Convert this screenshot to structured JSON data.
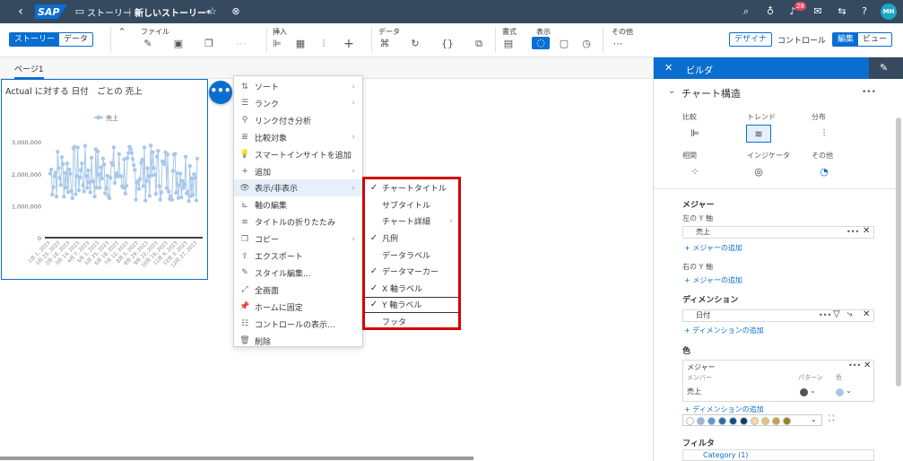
{
  "topbar": {
    "back": "‹",
    "logo": "SAP",
    "story_label": "ストーリー",
    "doc_title": "新しいストーリー*",
    "badge": "28",
    "avatar": "MH"
  },
  "toolbar": {
    "story_tab": "ストーリー",
    "data_tab": "データ",
    "file_label": "ファイル",
    "insert_label": "挿入",
    "data_label": "データ",
    "format_label": "書式",
    "view_label": "表示",
    "other_label": "その他",
    "designer_btn": "デザイナ",
    "control_btn": "コントロール",
    "edit_tab": "編集",
    "view_tab": "ビュー"
  },
  "page": {
    "tab_label": "ページ1"
  },
  "chart": {
    "title": "Actual に対する 日付　ごとの 売上",
    "legend": "売上",
    "color": "#a8c8ea"
  },
  "chart_data": {
    "type": "line",
    "title": "Actual に対する 日付　ごとの 売上",
    "series": [
      {
        "name": "売上"
      }
    ],
    "y_ticks": [
      "3,000,000",
      "2,000,000",
      "1,000,000",
      "0"
    ],
    "x_ticks": [
      "1月 1, 2023",
      "1月 25, 2023",
      "2月 18, 2023",
      "3月 14, 2023",
      "4月 7, 2023",
      "5月 1, 2023",
      "5月 25, 2023",
      "6月 18, 2023",
      "7月 12, 2023",
      "8月 5, 2023",
      "8月 29, 2023",
      "9月 22, 2023",
      "10月 16, 2023",
      "11月 9, 2023",
      "12月 3, 2023",
      "12月 27, 2023"
    ],
    "ylim": [
      0,
      3200000
    ]
  },
  "context_menu": [
    {
      "icon": "⇅",
      "label": "ソート",
      "arrow": true
    },
    {
      "icon": "☰",
      "label": "ランク",
      "arrow": true
    },
    {
      "icon": "⚲",
      "label": "リンク付き分析",
      "arrow": false
    },
    {
      "icon": "≣",
      "label": "比較対象",
      "arrow": true
    },
    {
      "icon": "💡",
      "label": "スマートインサイトを追加",
      "arrow": false
    },
    {
      "icon": "+",
      "label": "追加",
      "arrow": true
    },
    {
      "icon": "👁",
      "label": "表示/非表示",
      "arrow": true,
      "highlight": true
    },
    {
      "icon": "⊾",
      "label": "軸の編集",
      "arrow": false
    },
    {
      "icon": "≡",
      "label": "タイトルの折りたたみ",
      "arrow": false
    },
    {
      "icon": "❐",
      "label": "コピー",
      "arrow": true
    },
    {
      "icon": "⇪",
      "label": "エクスポート",
      "arrow": false
    },
    {
      "icon": "✎",
      "label": "スタイル編集...",
      "arrow": false
    },
    {
      "icon": "⤢",
      "label": "全画面",
      "arrow": false
    },
    {
      "icon": "📌",
      "label": "ホームに固定",
      "arrow": false
    },
    {
      "icon": "☷",
      "label": "コントロールの表示...",
      "arrow": false
    },
    {
      "icon": "🗑",
      "label": "削除",
      "arrow": false
    }
  ],
  "submenu": [
    {
      "label": "チャートタイトル",
      "checked": true,
      "arrow": false
    },
    {
      "label": "サブタイトル",
      "checked": false,
      "arrow": false
    },
    {
      "label": "チャート詳細",
      "checked": false,
      "arrow": true
    },
    {
      "label": "凡例",
      "checked": true,
      "arrow": false
    },
    {
      "label": "データラベル",
      "checked": false,
      "arrow": false
    },
    {
      "label": "データマーカー",
      "checked": true,
      "arrow": false
    },
    {
      "label": "X 軸ラベル",
      "checked": true,
      "arrow": false
    },
    {
      "label": "Y 軸ラベル",
      "checked": true,
      "arrow": false
    },
    {
      "label": "フッタ",
      "checked": false,
      "arrow": false
    }
  ],
  "builder": {
    "header": "ビルダ",
    "structure_title": "チャート構造",
    "categories": [
      {
        "label": "比較",
        "icon": "⊫"
      },
      {
        "label": "トレンド",
        "icon": "≋"
      },
      {
        "label": "分布",
        "icon": "⫶"
      },
      {
        "label": "相関",
        "icon": "⁘"
      },
      {
        "label": "インジケータ",
        "icon": "◎"
      },
      {
        "label": "その他",
        "icon": "◔"
      }
    ],
    "measures_title": "メジャー",
    "left_axis": "左の Y 軸",
    "left_measure": "売上",
    "add_measure": "+ メジャーの追加",
    "right_axis": "右の Y 軸",
    "add_measure2": "+ メジャーの追加",
    "dimensions_title": "ディメンション",
    "dimension": "日付",
    "add_dimension": "+ ディメンションの追加",
    "color_title": "色",
    "color_measure": "メジャー",
    "member_col": "メンバー",
    "pattern_col": "パターン",
    "color_col": "色",
    "color_row": "売上",
    "add_dimension2": "+ ディメンションの追加",
    "palette": [
      "#ffffff",
      "#8fb7e0",
      "#5899d6",
      "#1f6fb2",
      "#0b4f8a",
      "#0a3d6b",
      "#f5dc9e",
      "#e7c56c",
      "#c8a040",
      "#9e7b1e"
    ],
    "filter_title": "フィルタ",
    "filter_item": "Category (1)"
  }
}
